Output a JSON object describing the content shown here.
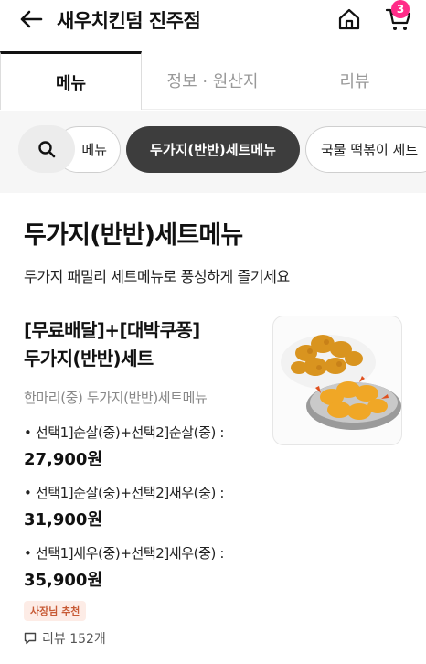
{
  "header": {
    "title": "새우치킨덤 진주점",
    "cart_count": "3"
  },
  "tabs": [
    {
      "label": "메뉴"
    },
    {
      "label": "정보 · 원산지"
    },
    {
      "label": "리뷰"
    }
  ],
  "categories": [
    {
      "label": "메뉴"
    },
    {
      "label": "두가지(반반)세트메뉴"
    },
    {
      "label": "국물 떡볶이 세트"
    }
  ],
  "section": {
    "title": "두가지(반반)세트메뉴",
    "description": "두가지 패밀리 세트메뉴로 풍성하게 즐기세요"
  },
  "item": {
    "name_line1": "[무료배달]+[대박쿠퐁]",
    "name_line2": "두가지(반반)세트",
    "subtitle": "한마리(중) 두가지(반반)세트메뉴",
    "options": [
      {
        "label": "• 선택1]순살(중)+선택2]순살(중) :",
        "price": "27,900원"
      },
      {
        "label": "• 선택1]순살(중)+선택2]새우(중) :",
        "price": "31,900원"
      },
      {
        "label": "• 선택1]새우(중)+선택2]새우(중) :",
        "price": "35,900원"
      }
    ],
    "badge": "사장님 추천",
    "review": "리뷰 152개"
  },
  "colors": {
    "accent_badge": "#ff2b88",
    "selected_chip": "#3d3d3d",
    "owner_badge_bg": "#fdece6",
    "owner_badge_text": "#c75a35"
  }
}
